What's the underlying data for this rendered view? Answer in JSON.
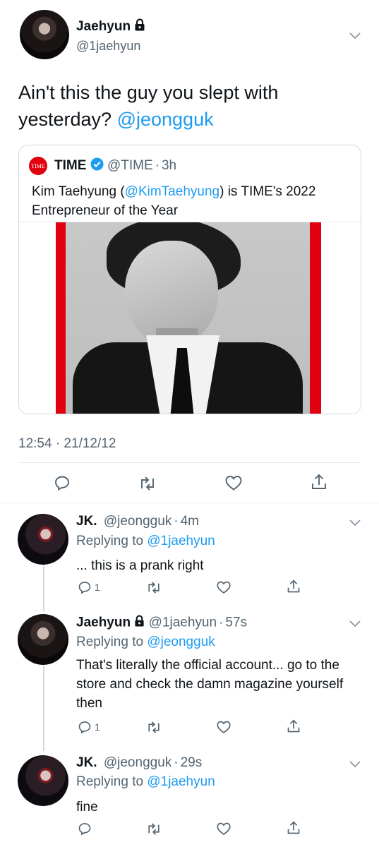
{
  "main_tweet": {
    "author_name": "Jaehyun",
    "author_handle": "@1jaehyun",
    "text_prefix": "Ain't this the guy you slept with yesterday? ",
    "text_mention": "@jeongguk",
    "timestamp": "12:54 · 21/12/12"
  },
  "quoted": {
    "logo_text": "TIME",
    "name": "TIME",
    "handle": "@TIME",
    "sep": "·",
    "age": "3h",
    "text_a": "Kim Taehyung (",
    "text_mention": "@KimTaehyung",
    "text_b": ") is TIME's 2022 Entrepreneur of the Year"
  },
  "replies": [
    {
      "name": "JK.",
      "handle": "@jeongguk",
      "sep": "·",
      "age": "4m",
      "replying_label": "Replying to ",
      "replying_to": "@1jaehyun",
      "text": "... this is a prank right",
      "reply_count": "1"
    },
    {
      "name": "Jaehyun",
      "handle": "@1jaehyun",
      "sep": "·",
      "age": "57s",
      "replying_label": "Replying to ",
      "replying_to": "@jeongguk",
      "text": "That's literally the official account... go to the store and check the damn magazine yourself then",
      "reply_count": "1"
    },
    {
      "name": "JK.",
      "handle": "@jeongguk",
      "sep": "·",
      "age": "29s",
      "replying_label": "Replying to ",
      "replying_to": "@1jaehyun",
      "text": "fine",
      "reply_count": ""
    }
  ],
  "colors": {
    "accent": "#1d9bf0",
    "time_red": "#e1000f",
    "muted": "#536471"
  },
  "icons": [
    "lock-icon",
    "verified-icon",
    "chevron-down-icon",
    "reply-icon",
    "retweet-icon",
    "like-icon",
    "share-icon"
  ]
}
